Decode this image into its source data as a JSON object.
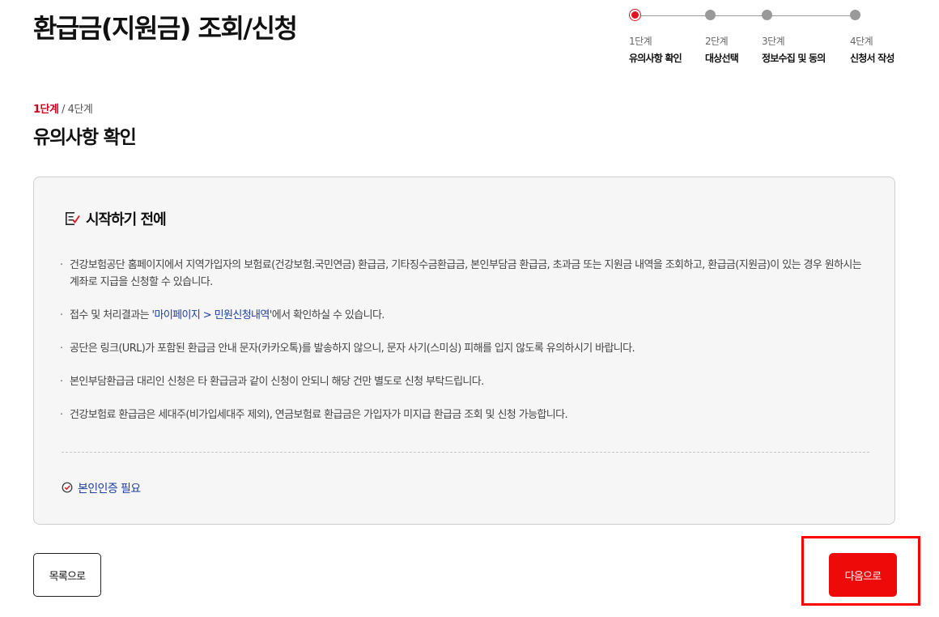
{
  "page_title": "환급금(지원금) 조회/신청",
  "stepper": {
    "steps": [
      {
        "num": "1단계",
        "name": "유의사항 확인",
        "active": true
      },
      {
        "num": "2단계",
        "name": "대상선택",
        "active": false
      },
      {
        "num": "3단계",
        "name": "정보수집 및 동의",
        "active": false
      },
      {
        "num": "4단계",
        "name": "신청서 작성",
        "active": false
      }
    ]
  },
  "step_indicator": {
    "current": "1단계",
    "total": " / 4단계"
  },
  "section_title": "유의사항 확인",
  "info_box": {
    "title": "시작하기 전에",
    "notices": [
      {
        "text": "건강보험공단 홈페이지에서 지역가입자의 보험료(건강보험.국민연금) 환급금, 기타징수금환급금, 본인부담금 환급금, 초과금 또는 지원금 내역을 조회하고, 환급금(지원금)이 있는 경우 원하시는 계좌로 지급을 신청할 수 있습니다."
      },
      {
        "pre": "접수 및 처리결과는 '",
        "link": "마이페이지 > 민원신청내역",
        "post": "'에서 확인하실 수 있습니다."
      },
      {
        "text": "공단은 링크(URL)가 포함된 환급금 안내 문자(카카오톡)를 발송하지 않으니, 문자 사기(스미싱) 피해를 입지 않도록 유의하시기 바랍니다."
      },
      {
        "text": "본인부담환급금 대리인 신청은 타 환급금과 같이 신청이 안되니 해당 건만 별도로 신청 부탁드립니다."
      },
      {
        "text": "건강보험료 환급금은 세대주(비가입세대주 제외), 연금보험료 환급금은 가입자가 미지급 환급금 조회 및 신청 가능합니다."
      }
    ],
    "cert_label": "본인인증 필요"
  },
  "buttons": {
    "list": "목록으로",
    "next": "다음으로"
  },
  "colors": {
    "accent": "#ef0a0a",
    "link": "#1d3f9f",
    "box_bg": "#f6f6f6"
  },
  "icons": {
    "checklist": "checklist-icon",
    "check_circle": "check-circle-icon"
  }
}
